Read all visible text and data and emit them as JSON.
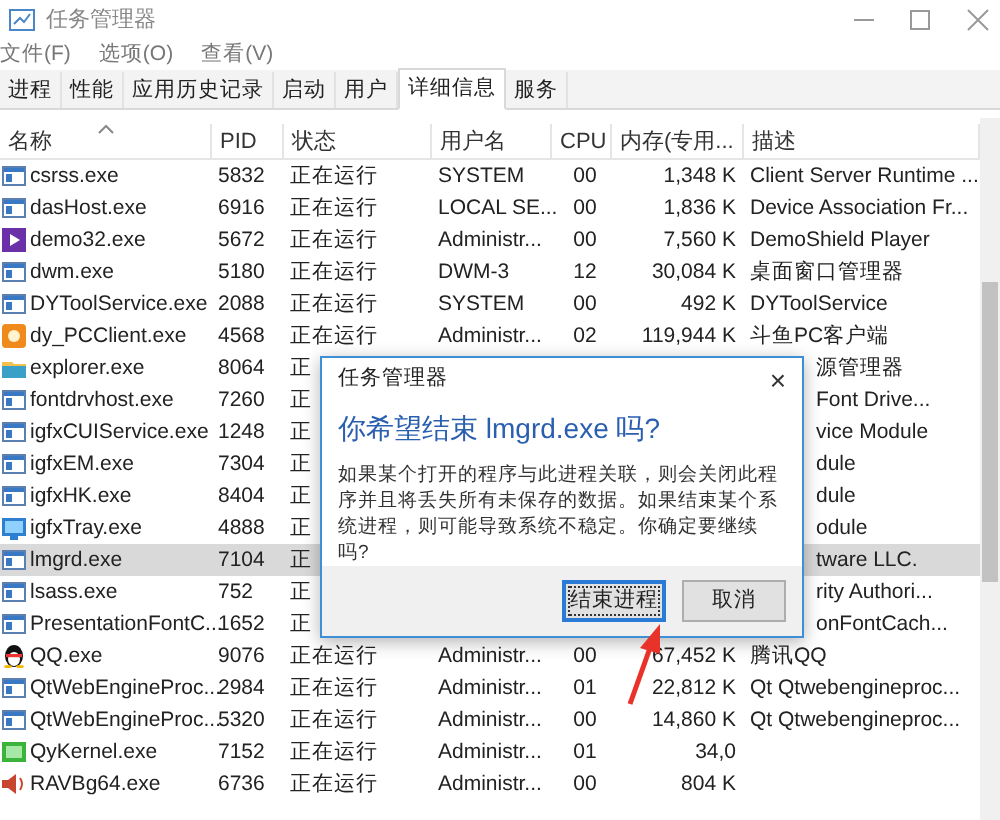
{
  "window": {
    "title": "任务管理器"
  },
  "menu": [
    "文件(F)",
    "选项(O)",
    "查看(V)"
  ],
  "tabs": [
    {
      "label": "进程",
      "selected": false
    },
    {
      "label": "性能",
      "selected": false
    },
    {
      "label": "应用历史记录",
      "selected": false
    },
    {
      "label": "启动",
      "selected": false
    },
    {
      "label": "用户",
      "selected": false
    },
    {
      "label": "详细信息",
      "selected": true
    },
    {
      "label": "服务",
      "selected": false
    }
  ],
  "table": {
    "columns": [
      "名称",
      "PID",
      "状态",
      "用户名",
      "CPU",
      "内存(专用...",
      "描述"
    ],
    "rows": [
      {
        "kind": "exe",
        "name": "csrss.exe",
        "pid": "5832",
        "status": "正在运行",
        "user": "SYSTEM",
        "cpu": "00",
        "memory": "1,348 K",
        "description": "Client Server Runtime ...",
        "selected": false
      },
      {
        "kind": "exe",
        "name": "dasHost.exe",
        "pid": "6916",
        "status": "正在运行",
        "user": "LOCAL SE...",
        "cpu": "00",
        "memory": "1,836 K",
        "description": "Device Association Fr...",
        "selected": false
      },
      {
        "kind": "player",
        "name": "demo32.exe",
        "pid": "5672",
        "status": "正在运行",
        "user": "Administr...",
        "cpu": "00",
        "memory": "7,560 K",
        "description": "DemoShield Player",
        "selected": false
      },
      {
        "kind": "exe",
        "name": "dwm.exe",
        "pid": "5180",
        "status": "正在运行",
        "user": "DWM-3",
        "cpu": "12",
        "memory": "30,084 K",
        "description": "桌面窗口管理器",
        "selected": false
      },
      {
        "kind": "exe",
        "name": "DYToolService.exe",
        "pid": "2088",
        "status": "正在运行",
        "user": "SYSTEM",
        "cpu": "00",
        "memory": "492 K",
        "description": "DYToolService",
        "selected": false
      },
      {
        "kind": "client",
        "name": "dy_PCClient.exe",
        "pid": "4568",
        "status": "正在运行",
        "user": "Administr...",
        "cpu": "02",
        "memory": "119,944 K",
        "description": "斗鱼PC客户端",
        "selected": false
      },
      {
        "kind": "folder",
        "name": "explorer.exe",
        "pid": "8064",
        "status": "正",
        "description": "源管理器",
        "covered_by_dialog": true,
        "selected": false
      },
      {
        "kind": "exe",
        "name": "fontdrvhost.exe",
        "pid": "7260",
        "status": "正",
        "description": "Font Drive...",
        "covered_by_dialog": true,
        "selected": false
      },
      {
        "kind": "exe",
        "name": "igfxCUIService.exe",
        "pid": "1248",
        "status": "正",
        "description": "vice Module",
        "covered_by_dialog": true,
        "selected": false
      },
      {
        "kind": "exe",
        "name": "igfxEM.exe",
        "pid": "7304",
        "status": "正",
        "description": "dule",
        "covered_by_dialog": true,
        "selected": false
      },
      {
        "kind": "exe",
        "name": "igfxHK.exe",
        "pid": "8404",
        "status": "正",
        "description": "dule",
        "covered_by_dialog": true,
        "selected": false
      },
      {
        "kind": "display",
        "name": "igfxTray.exe",
        "pid": "4888",
        "status": "正",
        "description": "odule",
        "covered_by_dialog": true,
        "selected": false
      },
      {
        "kind": "exe",
        "name": "lmgrd.exe",
        "pid": "7104",
        "status": "正",
        "description": "tware LLC.",
        "covered_by_dialog": true,
        "selected": true
      },
      {
        "kind": "exe",
        "name": "lsass.exe",
        "pid": "752",
        "status": "正",
        "description": "rity Authori...",
        "covered_by_dialog": true,
        "selected": false
      },
      {
        "kind": "exe",
        "name": "PresentationFontC...",
        "pid": "1652",
        "status": "正",
        "description": "onFontCach...",
        "covered_by_dialog": true,
        "selected": false
      },
      {
        "kind": "penguin",
        "name": "QQ.exe",
        "pid": "9076",
        "status": "正在运行",
        "user": "Administr...",
        "cpu": "00",
        "memory": "67,452 K",
        "description": "腾讯QQ",
        "selected": false
      },
      {
        "kind": "exe",
        "name": "QtWebEngineProc...",
        "pid": "2984",
        "status": "正在运行",
        "user": "Administr...",
        "cpu": "01",
        "memory": "22,812 K",
        "description": "Qt Qtwebengineproc...",
        "selected": false
      },
      {
        "kind": "exe",
        "name": "QtWebEngineProc...",
        "pid": "5320",
        "status": "正在运行",
        "user": "Administr...",
        "cpu": "00",
        "memory": "14,860 K",
        "description": "Qt Qtwebengineproc...",
        "selected": false
      },
      {
        "kind": "kernel",
        "name": "QyKernel.exe",
        "pid": "7152",
        "status": "正在运行",
        "user": "Administr...",
        "cpu": "01",
        "memory": "34,0",
        "selected": false
      },
      {
        "kind": "speaker",
        "name": "RAVBg64.exe",
        "pid": "6736",
        "status": "正在运行",
        "user": "Administr...",
        "cpu": "00",
        "memory": "804 K",
        "selected": false
      }
    ]
  },
  "dialog": {
    "title": "任务管理器",
    "close": "×",
    "heading": "你希望结束 lmgrd.exe 吗?",
    "message": "如果某个打开的程序与此进程关联，则会关闭此程序并且将丢失所有未保存的数据。如果结束某个系统进程，则可能导致系统不稳定。你确定要继续吗?",
    "buttons": [
      {
        "label": "结束进程",
        "focused": true
      },
      {
        "label": "取消",
        "focused": false
      }
    ]
  }
}
